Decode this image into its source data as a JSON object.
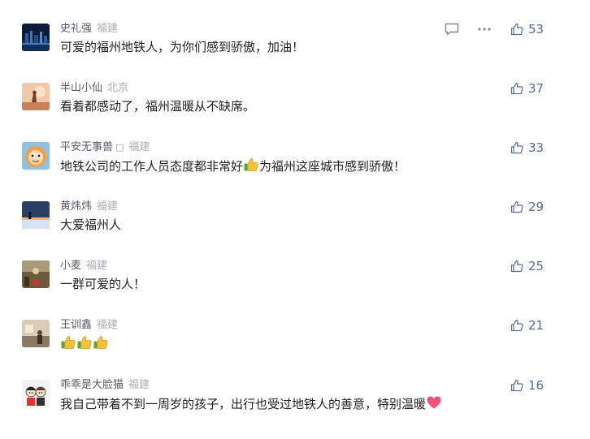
{
  "comments": [
    {
      "name": "史礼强",
      "location": "福建",
      "text": "可爱的福州地铁人，为你们感到骄傲，加油！",
      "likes": "53",
      "avatar_icon": "avatar-city-night"
    },
    {
      "name": "半山小仙",
      "location": "北京",
      "text": "看着都感动了，福州温暖从不缺席。",
      "likes": "37",
      "avatar_icon": "avatar-sunset-figure"
    },
    {
      "name": "平安无事兽",
      "badge": "□",
      "location": "福建",
      "text_before": "地铁公司的工作人员态度都非常好",
      "text_after": "为福州这座城市感到骄傲！",
      "emoji": "thumbs-up-icon",
      "likes": "33",
      "avatar_icon": "avatar-cartoon-face"
    },
    {
      "name": "黄炜炜",
      "location": "福建",
      "text": "大爱福州人",
      "likes": "29",
      "avatar_icon": "avatar-silhouette-sunset"
    },
    {
      "name": "小麦",
      "location": "福建",
      "text": "一群可爱的人！",
      "likes": "25",
      "avatar_icon": "avatar-sitting-person"
    },
    {
      "name": "王训鑫",
      "location": "福建",
      "text": "",
      "emoji": "thumbs-up-icon",
      "emoji_count": 3,
      "likes": "21",
      "avatar_icon": "avatar-room-photo"
    },
    {
      "name": "乖乖是大脸猫",
      "location": "福建",
      "text_before": "我自己带着不到一周岁的孩子，出行也受过地铁人的善意，特别温暖",
      "emoji": "heart-icon",
      "likes": "16",
      "avatar_icon": "avatar-couple-cartoon"
    }
  ],
  "actions": {
    "reply_icon": "comment-icon",
    "more_icon": "more-dots-icon"
  },
  "colors": {
    "like_blue": "#576b95",
    "name_gray": "#555b6a",
    "location_gray": "#a8acb4"
  }
}
